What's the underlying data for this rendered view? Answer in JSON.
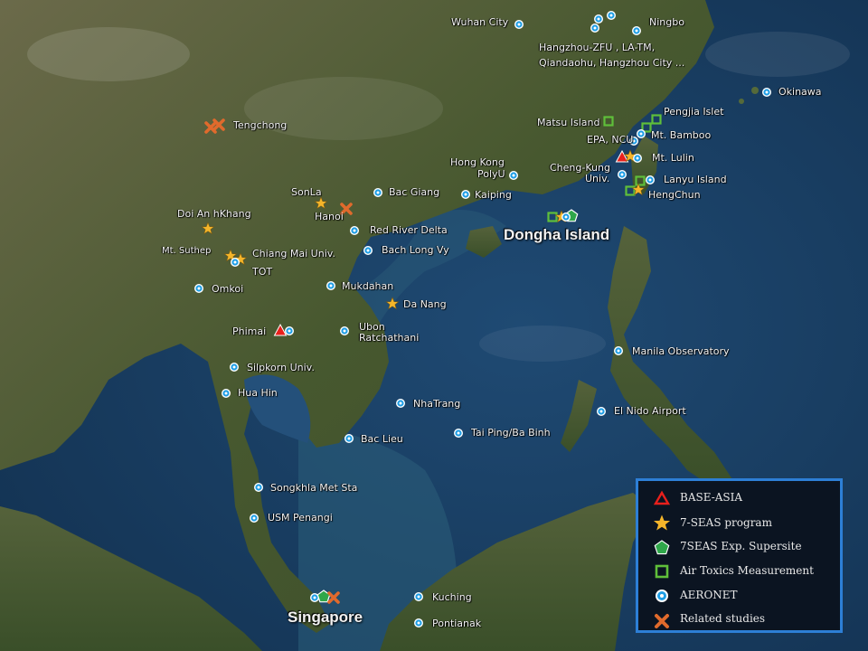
{
  "colors": {
    "ocean": "#1d4468",
    "land": "#4a5a34",
    "aeronet": "#1e9ee6",
    "star": "#f5b52a",
    "base_asia": "#e8201c",
    "air_toxics": "#5fbf3a",
    "supersite": "#2fa74a",
    "related": "#e06a2c",
    "legend_border": "#2d7fd6"
  },
  "labels": {
    "wuhan": "Wuhan City",
    "ningbo": "Ningbo",
    "hangzhou": "Hangzhou-ZFU , LA-TM,",
    "hangzhou2": "Qiandaohu, Hangzhou City ...",
    "okinawa": "Okinawa",
    "pengjia": "Pengjia Islet",
    "matsu": "Matsu Island",
    "mtbamboo": "Mt. Bamboo",
    "epa": "EPA, NCU",
    "mtlulin": "Mt. Lulin",
    "chengkung": "Cheng-Kung",
    "chengkung2": "Univ.",
    "lanyu": "Lanyu Island",
    "hengchun": "HengChun",
    "hongkong": "Hong Kong",
    "polyu": "PolyU",
    "kaiping": "Kaiping",
    "tengchong": "Tengchong",
    "sonla": "SonLa",
    "bacgiang": "Bac Giang",
    "hanoi": "Hanoi",
    "doian": "Doi An hKhang",
    "reddelta": "Red River Delta",
    "bachlong": "Bach Long Vy",
    "dongha": "Dongha Island",
    "mtsuthep": "Mt. Suthep",
    "chiangmai": "Chiang Mai Univ.",
    "tot": "TOT",
    "omkoi": "Omkoi",
    "mukdahan": "Mukdahan",
    "danang": "Da Nang",
    "phimai": "Phimai",
    "ubon": "Ubon",
    "ubon2": "Ratchathani",
    "manila": "Manila Observatory",
    "silpkorn": "Silpkorn Univ.",
    "huahin": "Hua Hin",
    "nhatrang": "NhaTrang",
    "elnido": "El Nido Airport",
    "taiping": "Tai Ping/Ba Binh",
    "baclieu": "Bac Lieu",
    "songkhla": "Songkhla Met Sta",
    "usm": "USM Penangi",
    "singapore": "Singapore",
    "kuching": "Kuching",
    "pontianak": "Pontianak"
  },
  "legend": {
    "base_asia": "BASE-ASIA",
    "seas": "7-SEAS program",
    "supersite": "7SEAS Exp. Supersite",
    "air_toxics": "Air Toxics Measurement",
    "aeronet": "AERONET",
    "related": "Related studies"
  },
  "icons": {
    "base_asia": "triangle-icon",
    "seas": "star-icon",
    "supersite": "pentagon-icon",
    "air_toxics": "square-icon",
    "aeronet": "circle-icon",
    "related": "cross-icon"
  }
}
